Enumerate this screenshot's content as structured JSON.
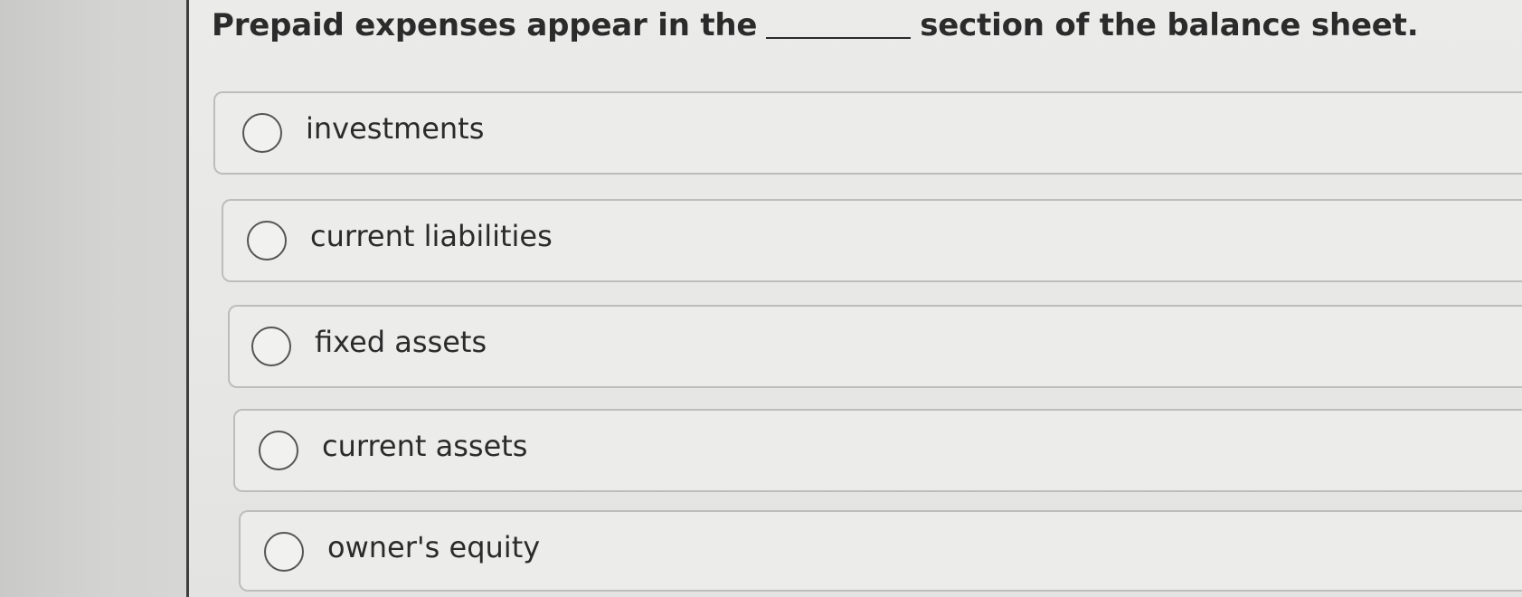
{
  "question": {
    "before_blank": "Prepaid expenses appear in the",
    "after_blank": "section of the balance sheet."
  },
  "options": [
    {
      "label": "investments",
      "selected": false
    },
    {
      "label": "current liabilities",
      "selected": false
    },
    {
      "label": "fixed assets",
      "selected": false
    },
    {
      "label": "current assets",
      "selected": false
    },
    {
      "label": "owner's equity",
      "selected": false
    }
  ]
}
